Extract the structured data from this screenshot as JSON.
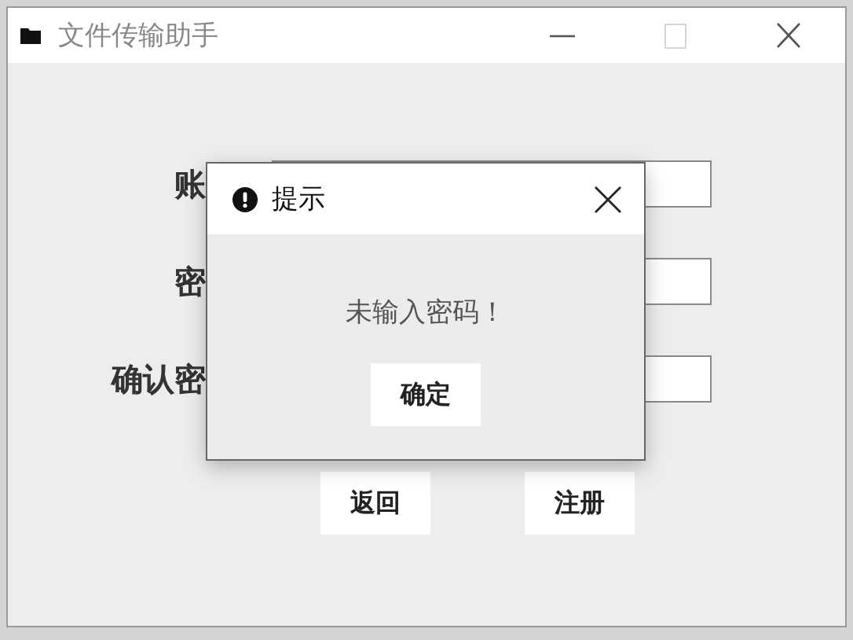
{
  "window": {
    "title": "文件传输助手",
    "controls": [
      {
        "kind": "minimize",
        "disabled": false
      },
      {
        "kind": "maximize",
        "disabled": true
      },
      {
        "kind": "close",
        "disabled": false
      }
    ]
  },
  "form": {
    "fields": [
      {
        "label": "账"
      },
      {
        "label": "密"
      },
      {
        "label": "确认密"
      }
    ],
    "buttons": [
      "返回",
      "注册"
    ]
  },
  "dialog": {
    "title": "提示",
    "message": "未输入密码！",
    "button": "确定"
  }
}
